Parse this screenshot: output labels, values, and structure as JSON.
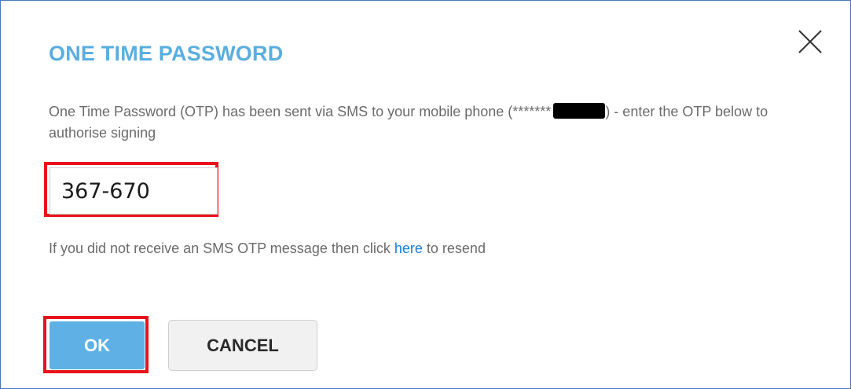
{
  "dialog": {
    "title": "ONE TIME PASSWORD",
    "close_icon": "close-icon",
    "message_before": "One Time Password (OTP) has been sent via SMS to your mobile phone (*******",
    "message_after": ") - enter the OTP below to authorise signing",
    "otp_value": "367-670",
    "resend_before": "If you did not receive an SMS OTP message then click ",
    "resend_link": "here",
    "resend_after": " to resend",
    "ok_label": "OK",
    "cancel_label": "CANCEL"
  },
  "colors": {
    "title": "#5aaee0",
    "ok_button": "#5eb0e5",
    "link": "#1a7ed6",
    "highlight": "#e8121c",
    "border": "#4a78b8"
  }
}
